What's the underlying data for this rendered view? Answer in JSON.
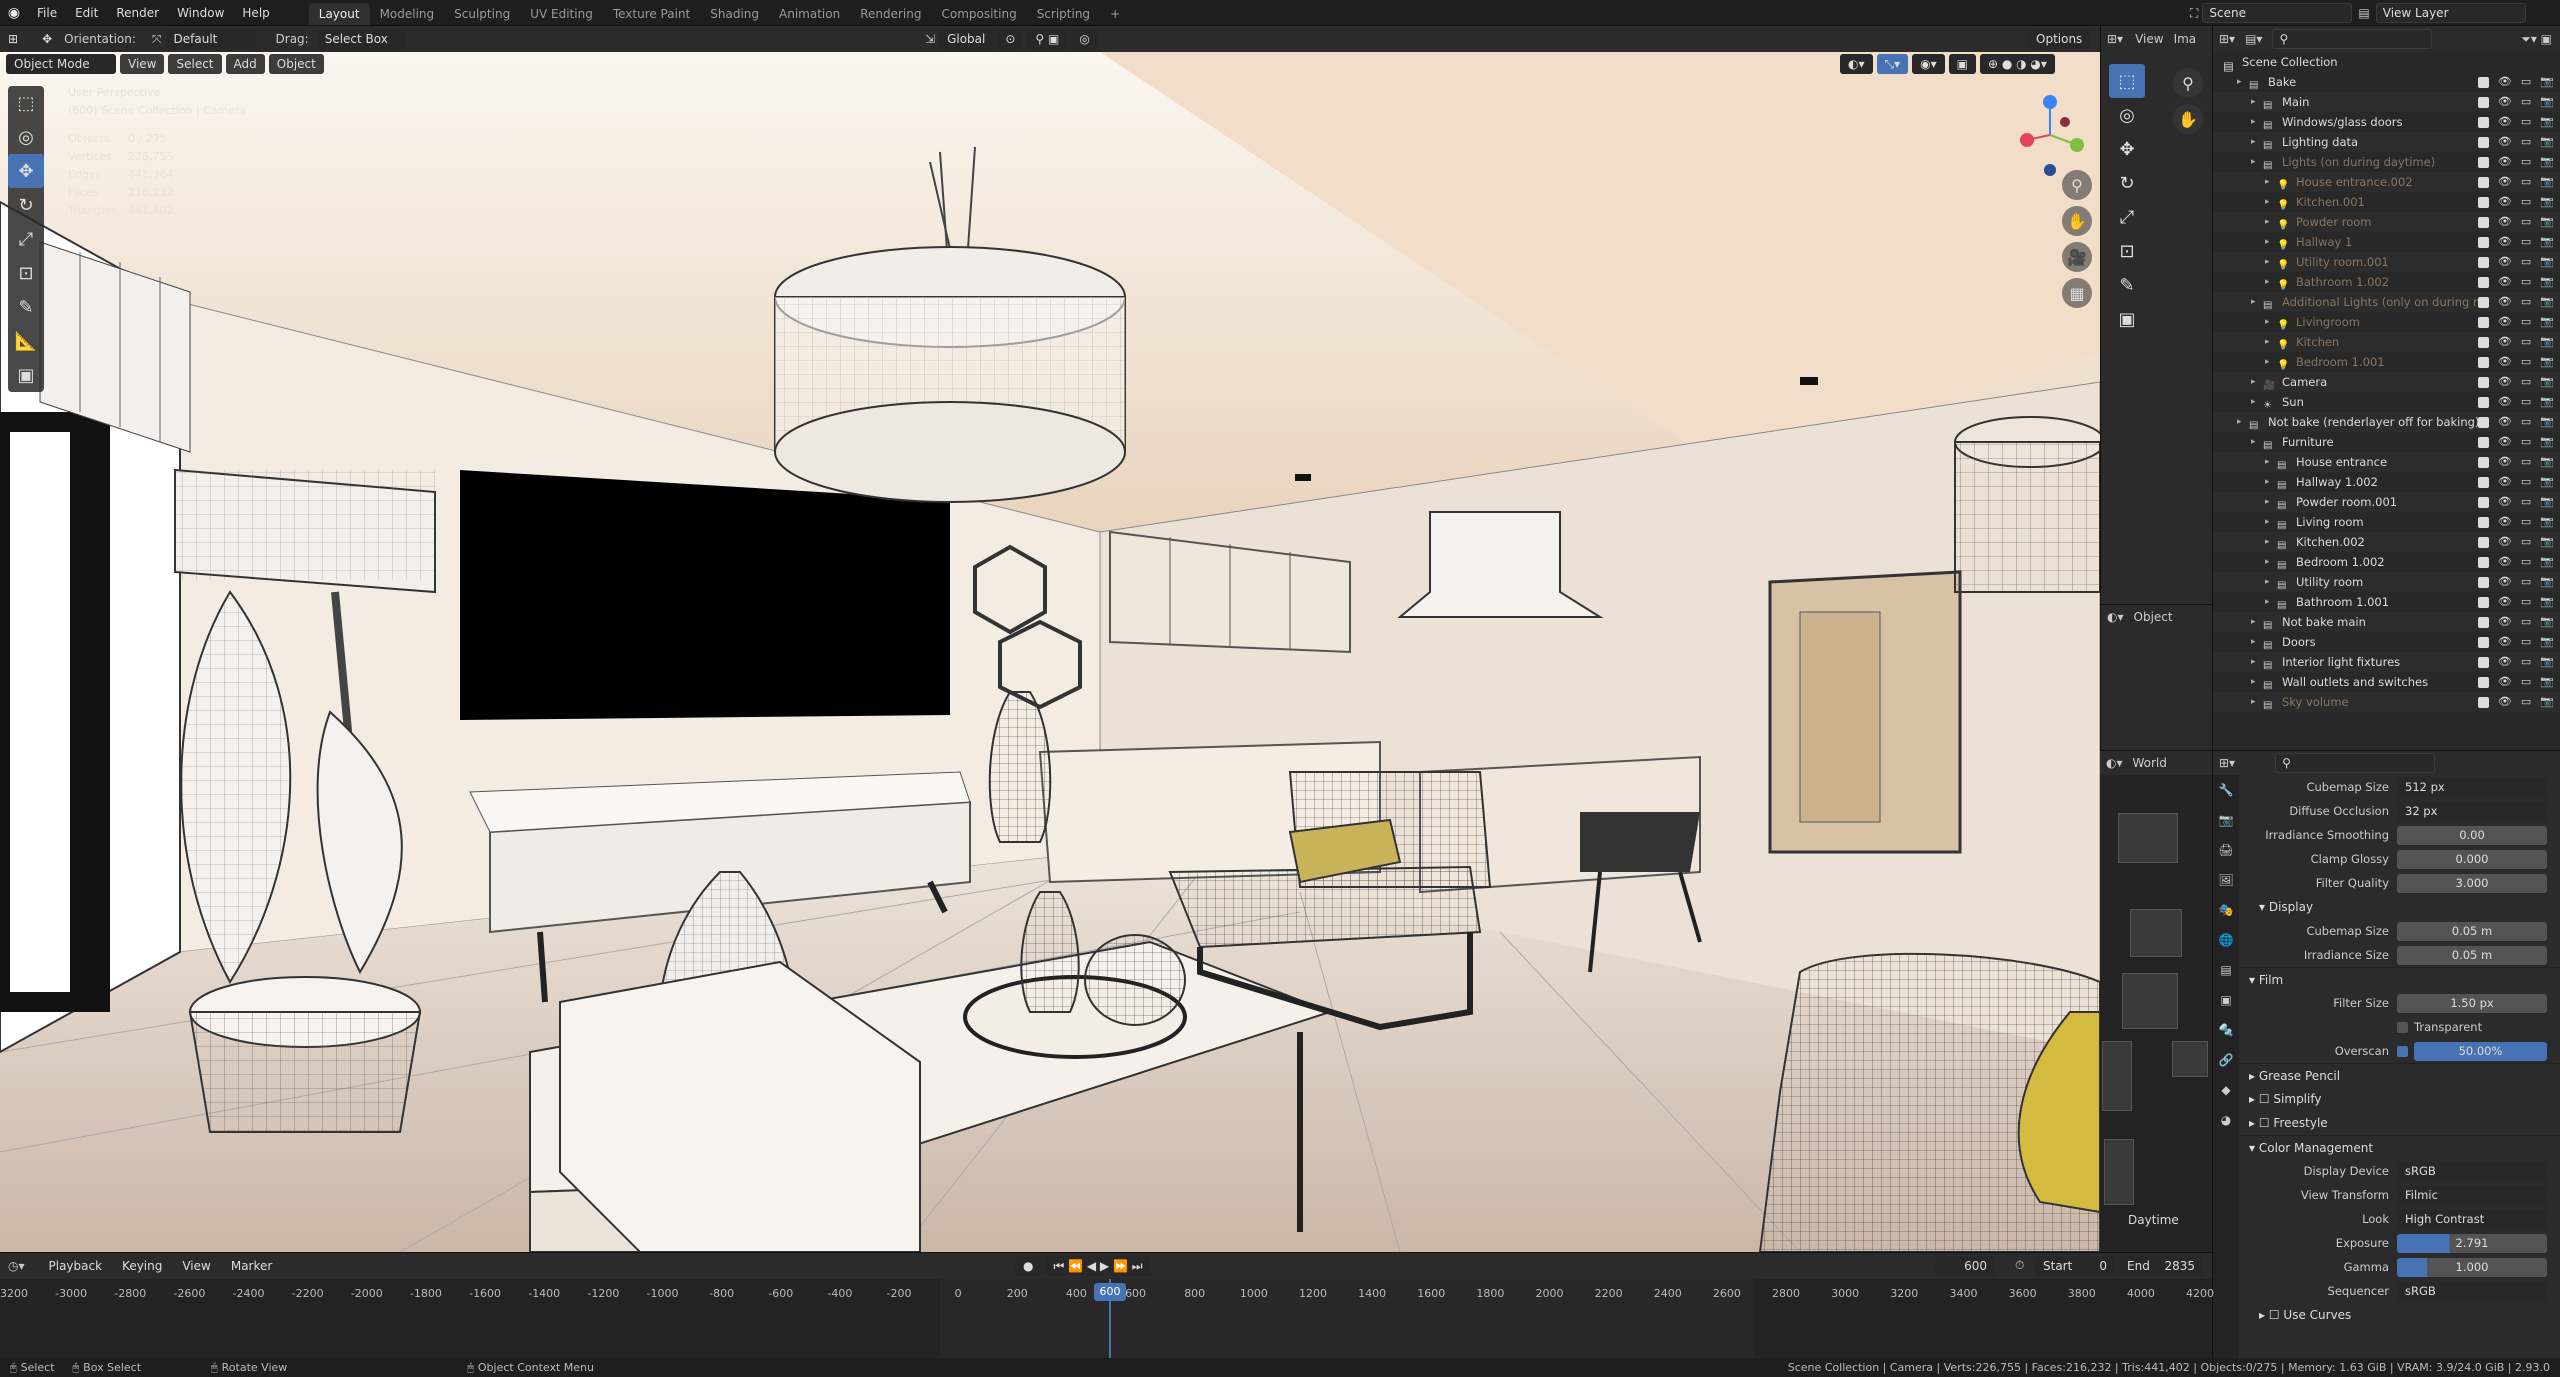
{
  "menu": [
    "File",
    "Edit",
    "Render",
    "Window",
    "Help"
  ],
  "workspaces": [
    "Layout",
    "Modeling",
    "Sculpting",
    "UV Editing",
    "Texture Paint",
    "Shading",
    "Animation",
    "Rendering",
    "Compositing",
    "Scripting"
  ],
  "header": {
    "orientation_label": "Orientation:",
    "orientation_value": "Default",
    "drag_label": "Drag:",
    "drag_value": "Select Box",
    "transform_orientation": "Global",
    "options": "Options",
    "scene": "Scene",
    "view_layer": "View Layer"
  },
  "viewport": {
    "mode": "Object Mode",
    "buttons": [
      "View",
      "Select",
      "Add",
      "Object"
    ],
    "overlay_title": "User Perspective",
    "overlay_sub": "(600) Scene Collection | Camera",
    "stats": [
      {
        "label": "Objects",
        "value": "0 / 275"
      },
      {
        "label": "Vertices",
        "value": "226,755"
      },
      {
        "label": "Edges",
        "value": "441,364"
      },
      {
        "label": "Faces",
        "value": "216,232"
      },
      {
        "label": "Triangles",
        "value": "441,402"
      }
    ]
  },
  "right_tools": {
    "view": "View",
    "image": "Ima",
    "object": "Object",
    "world": "World",
    "daytime": "Daytime"
  },
  "outliner": {
    "root": "Scene Collection",
    "rows": [
      {
        "name": "Bake",
        "indent": 1,
        "dim": false,
        "icon": "collection"
      },
      {
        "name": "Main",
        "indent": 2,
        "dim": false,
        "icon": "collection"
      },
      {
        "name": "Windows/glass doors",
        "indent": 2,
        "dim": false,
        "icon": "collection"
      },
      {
        "name": "Lighting data",
        "indent": 2,
        "dim": false,
        "icon": "collection"
      },
      {
        "name": "Lights (on during daytime)",
        "indent": 2,
        "dim": true,
        "icon": "collection"
      },
      {
        "name": "House entrance.002",
        "indent": 3,
        "dim": true,
        "icon": "light"
      },
      {
        "name": "Kitchen.001",
        "indent": 3,
        "dim": true,
        "icon": "light"
      },
      {
        "name": "Powder room",
        "indent": 3,
        "dim": true,
        "icon": "light"
      },
      {
        "name": "Hallway 1",
        "indent": 3,
        "dim": true,
        "icon": "light"
      },
      {
        "name": "Utility room.001",
        "indent": 3,
        "dim": true,
        "icon": "light"
      },
      {
        "name": "Bathroom 1.002",
        "indent": 3,
        "dim": true,
        "icon": "light"
      },
      {
        "name": "Additional Lights (only on during ni",
        "indent": 2,
        "dim": true,
        "icon": "collection"
      },
      {
        "name": "Livingroom",
        "indent": 3,
        "dim": true,
        "icon": "light"
      },
      {
        "name": "Kitchen",
        "indent": 3,
        "dim": true,
        "icon": "light"
      },
      {
        "name": "Bedroom 1.001",
        "indent": 3,
        "dim": true,
        "icon": "light"
      },
      {
        "name": "Camera",
        "indent": 2,
        "dim": false,
        "icon": "camera"
      },
      {
        "name": "Sun",
        "indent": 2,
        "dim": false,
        "icon": "sun"
      },
      {
        "name": "Not bake (renderlayer off for baking)",
        "indent": 1,
        "dim": false,
        "icon": "collection"
      },
      {
        "name": "Furniture",
        "indent": 2,
        "dim": false,
        "icon": "collection"
      },
      {
        "name": "House entrance",
        "indent": 3,
        "dim": false,
        "icon": "collection"
      },
      {
        "name": "Hallway 1.002",
        "indent": 3,
        "dim": false,
        "icon": "collection"
      },
      {
        "name": "Powder room.001",
        "indent": 3,
        "dim": false,
        "icon": "collection"
      },
      {
        "name": "Living room",
        "indent": 3,
        "dim": false,
        "icon": "collection"
      },
      {
        "name": "Kitchen.002",
        "indent": 3,
        "dim": false,
        "icon": "collection"
      },
      {
        "name": "Bedroom 1.002",
        "indent": 3,
        "dim": false,
        "icon": "collection"
      },
      {
        "name": "Utility room",
        "indent": 3,
        "dim": false,
        "icon": "collection"
      },
      {
        "name": "Bathroom 1.001",
        "indent": 3,
        "dim": false,
        "icon": "collection"
      },
      {
        "name": "Not bake main",
        "indent": 2,
        "dim": false,
        "icon": "collection"
      },
      {
        "name": "Doors",
        "indent": 2,
        "dim": false,
        "icon": "collection"
      },
      {
        "name": "Interior light fixtures",
        "indent": 2,
        "dim": false,
        "icon": "collection"
      },
      {
        "name": "Wall outlets and switches",
        "indent": 2,
        "dim": false,
        "icon": "collection"
      },
      {
        "name": "Sky volume",
        "indent": 2,
        "dim": true,
        "icon": "collection"
      }
    ]
  },
  "properties": {
    "top_rows": [
      {
        "label": "Cubemap Size",
        "value": "512 px"
      },
      {
        "label": "Diffuse Occlusion",
        "value": "32 px"
      },
      {
        "label": "Irradiance Smoothing",
        "value": "0.00"
      },
      {
        "label": "Clamp Glossy",
        "value": "0.000"
      },
      {
        "label": "Filter Quality",
        "value": "3.000"
      }
    ],
    "display_header": "Display",
    "display_rows": [
      {
        "label": "Cubemap Size",
        "value": "0.05 m"
      },
      {
        "label": "Irradiance Size",
        "value": "0.05 m"
      }
    ],
    "film_header": "Film",
    "film_filter_label": "Filter Size",
    "film_filter_value": "1.50 px",
    "film_transparent": "Transparent",
    "film_overscan_label": "Overscan",
    "film_overscan_value": "50.00%",
    "sections": [
      "Grease Pencil",
      "Simplify",
      "Freestyle"
    ],
    "color_header": "Color Management",
    "color_rows": [
      {
        "label": "Display Device",
        "value": "sRGB"
      },
      {
        "label": "View Transform",
        "value": "Filmic"
      },
      {
        "label": "Look",
        "value": "High Contrast"
      },
      {
        "label": "Exposure",
        "value": "2.791"
      },
      {
        "label": "Gamma",
        "value": "1.000"
      },
      {
        "label": "Sequencer",
        "value": "sRGB"
      }
    ],
    "use_curves": "Use Curves"
  },
  "timeline": {
    "menus": [
      "Playback",
      "Keying",
      "View",
      "Marker"
    ],
    "current_frame": "600",
    "start_label": "Start",
    "start_value": "0",
    "end_label": "End",
    "end_value": "2835",
    "ticks": [
      "-3200",
      "-3000",
      "-2800",
      "-2600",
      "-2400",
      "-2200",
      "-2000",
      "-1800",
      "-1600",
      "-1400",
      "-1200",
      "-1000",
      "-800",
      "-600",
      "-400",
      "-200",
      "0",
      "200",
      "400",
      "600",
      "800",
      "1000",
      "1200",
      "1400",
      "1600",
      "1800",
      "2000",
      "2200",
      "2400",
      "2600",
      "2800",
      "3000",
      "3200",
      "3400",
      "3600",
      "3800",
      "4000",
      "4200"
    ]
  },
  "status": {
    "select": "Select",
    "box_select": "Box Select",
    "rotate": "Rotate View",
    "context": "Object Context Menu",
    "info": "Scene Collection | Camera | Verts:226,755 | Faces:216,232 | Tris:441,402 | Objects:0/275 | Memory: 1.63 GiB | VRAM: 3.9/24.0 GiB | 2.93.0"
  },
  "colors": {
    "accent": "#4772b3",
    "orange": "#e8a25a",
    "bg": "#1d1d1d"
  }
}
